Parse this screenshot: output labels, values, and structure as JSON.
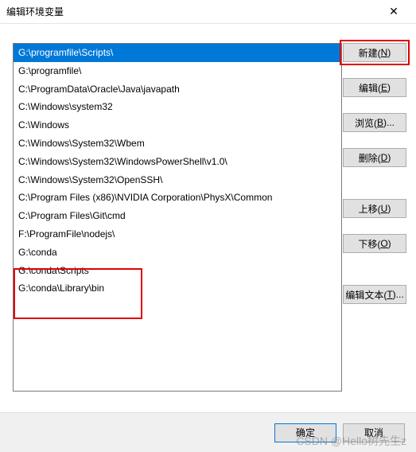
{
  "window": {
    "title": "编辑环境变量",
    "close_glyph": "✕"
  },
  "path_entries": [
    "G:\\programfile\\Scripts\\",
    "G:\\programfile\\",
    "C:\\ProgramData\\Oracle\\Java\\javapath",
    "C:\\Windows\\system32",
    "C:\\Windows",
    "C:\\Windows\\System32\\Wbem",
    "C:\\Windows\\System32\\WindowsPowerShell\\v1.0\\",
    "C:\\Windows\\System32\\OpenSSH\\",
    "C:\\Program Files (x86)\\NVIDIA Corporation\\PhysX\\Common",
    "C:\\Program Files\\Git\\cmd",
    "F:\\ProgramFile\\nodejs\\",
    "G:\\conda",
    "G:\\conda\\Scripts",
    "G:\\conda\\Library\\bin"
  ],
  "selected_index": 0,
  "buttons": {
    "new": {
      "pre": "新建(",
      "accel": "N",
      "post": ")"
    },
    "edit": {
      "pre": "编辑(",
      "accel": "E",
      "post": ")"
    },
    "browse": {
      "pre": "浏览(",
      "accel": "B",
      "post": ")..."
    },
    "delete": {
      "pre": "删除(",
      "accel": "D",
      "post": ")"
    },
    "moveup": {
      "pre": "上移(",
      "accel": "U",
      "post": ")"
    },
    "movedown": {
      "pre": "下移(",
      "accel": "O",
      "post": ")"
    },
    "edittext": {
      "pre": "编辑文本(",
      "accel": "T",
      "post": ")..."
    },
    "ok": "确定",
    "cancel": "取消"
  },
  "watermark": "CSDN @Hello树先生z"
}
